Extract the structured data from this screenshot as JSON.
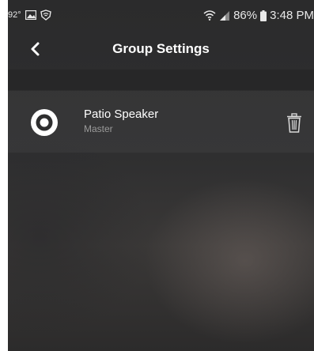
{
  "status_bar": {
    "temperature": "92°",
    "battery": "86%",
    "time": "3:48 PM"
  },
  "header": {
    "title": "Group Settings",
    "back_icon": "chevron-left-icon"
  },
  "group_members": [
    {
      "name": "Patio Speaker",
      "role": "Master",
      "icon": "speaker-icon",
      "action_icon": "trash-icon"
    }
  ],
  "colors": {
    "background": "#2e2e2f",
    "primary_text": "#ffffff",
    "secondary_text": "#9a9a9a"
  }
}
